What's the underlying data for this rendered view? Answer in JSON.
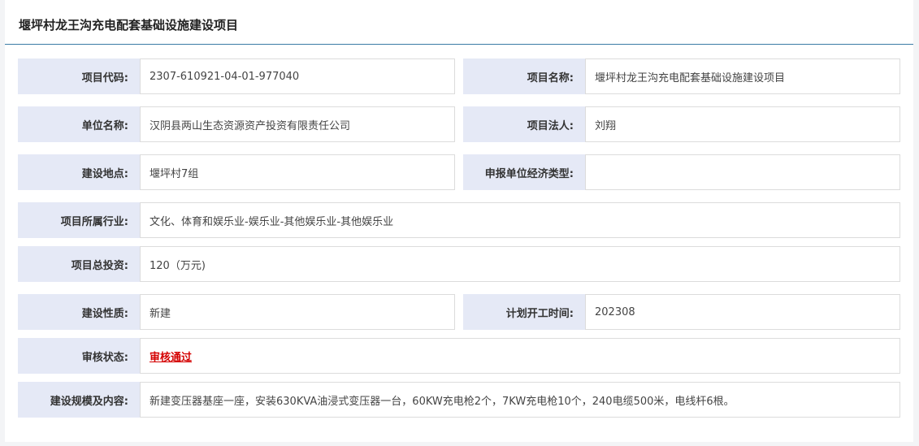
{
  "title": "堰坪村龙王沟充电配套基础设施建设项目",
  "fields": {
    "project_code": {
      "label": "项目代码:",
      "value": "2307-610921-04-01-977040"
    },
    "project_name": {
      "label": "项目名称:",
      "value": "堰坪村龙王沟充电配套基础设施建设项目"
    },
    "unit_name": {
      "label": "单位名称:",
      "value": "汉阴县两山生态资源资产投资有限责任公司"
    },
    "legal_person": {
      "label": "项目法人:",
      "value": "刘翔"
    },
    "location": {
      "label": "建设地点:",
      "value": "堰坪村7组"
    },
    "economic_type": {
      "label": "申报单位经济类型:",
      "value": ""
    },
    "industry": {
      "label": "项目所属行业:",
      "value": "文化、体育和娱乐业-娱乐业-其他娱乐业-其他娱乐业"
    },
    "investment": {
      "label": "项目总投资:",
      "value": "120（万元)"
    },
    "nature": {
      "label": "建设性质:",
      "value": "新建"
    },
    "start_time": {
      "label": "计划开工时间:",
      "value": "202308"
    },
    "review_status": {
      "label": "审核状态:",
      "value": "审核通过"
    },
    "scale": {
      "label": "建设规模及内容:",
      "value": "新建变压器基座一座，安装630KVA油浸式变压器一台，60KW充电枪2个，7KW充电枪10个，240电缆500米，电线杆6根。"
    }
  },
  "colors": {
    "label_bg": "#e5e9f6",
    "accent_line": "#3a7ca5",
    "status_ok": "#d40000"
  }
}
